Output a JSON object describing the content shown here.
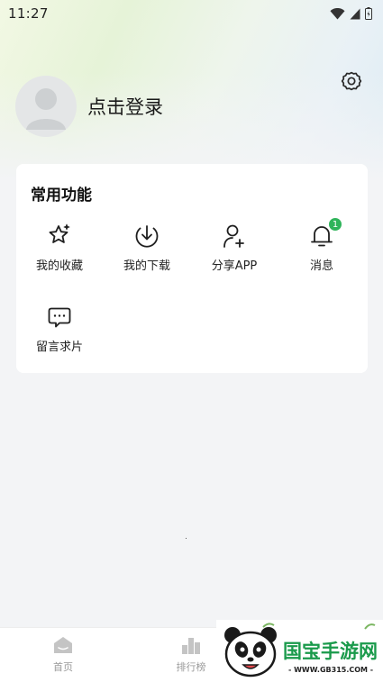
{
  "status_bar": {
    "time": "11:27"
  },
  "profile": {
    "login_label": "点击登录"
  },
  "common_functions": {
    "title": "常用功能",
    "items": [
      {
        "label": "我的收藏",
        "icon": "star-sparkle-icon"
      },
      {
        "label": "我的下载",
        "icon": "download-icon"
      },
      {
        "label": "分享APP",
        "icon": "add-user-icon"
      },
      {
        "label": "消息",
        "icon": "bell-icon",
        "badge": "1"
      },
      {
        "label": "留言求片",
        "icon": "message-icon"
      }
    ]
  },
  "bottom_nav": {
    "items": [
      {
        "label": "首页",
        "icon": "home-icon"
      },
      {
        "label": "排行榜",
        "icon": "chart-icon"
      }
    ]
  },
  "watermark": {
    "brand": "国宝手游网",
    "url": "- WWW.GB315.COM -"
  },
  "colors": {
    "accent": "#2fb45a",
    "card_bg": "#ffffff",
    "page_bg": "#f3f4f6"
  }
}
